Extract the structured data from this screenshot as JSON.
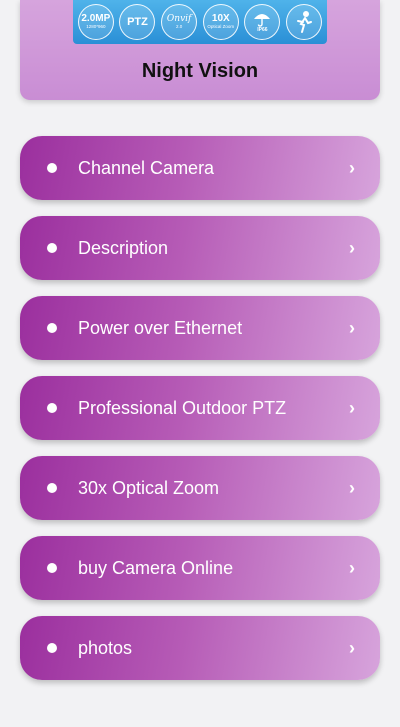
{
  "header": {
    "title": "Night Vision",
    "features": [
      {
        "main": "2.0MP",
        "sub": "1280*960"
      },
      {
        "main": "PTZ",
        "sub": ""
      },
      {
        "main": "Onvif",
        "sub": "2.0"
      },
      {
        "main": "10X",
        "sub": "Optical Zoom"
      },
      {
        "main": "",
        "sub": "IP66",
        "icon": "umbrella-icon"
      },
      {
        "main": "",
        "sub": "",
        "icon": "person-icon"
      }
    ]
  },
  "menu": {
    "items": [
      {
        "label": "Channel Camera",
        "chevron": "›"
      },
      {
        "label": "Description",
        "chevron": "›"
      },
      {
        "label": "Power over Ethernet",
        "chevron": "›"
      },
      {
        "label": "Professional Outdoor PTZ",
        "chevron": "›"
      },
      {
        "label": "30x Optical Zoom",
        "chevron": "›"
      },
      {
        "label": "buy Camera Online",
        "chevron": "›"
      },
      {
        "label": "photos",
        "chevron": "›"
      }
    ]
  },
  "colors": {
    "item_gradient_start": "#9b2f9e",
    "item_gradient_end": "#d7a4dc",
    "banner": "#2a8fd6",
    "background": "#f2f2f4"
  }
}
